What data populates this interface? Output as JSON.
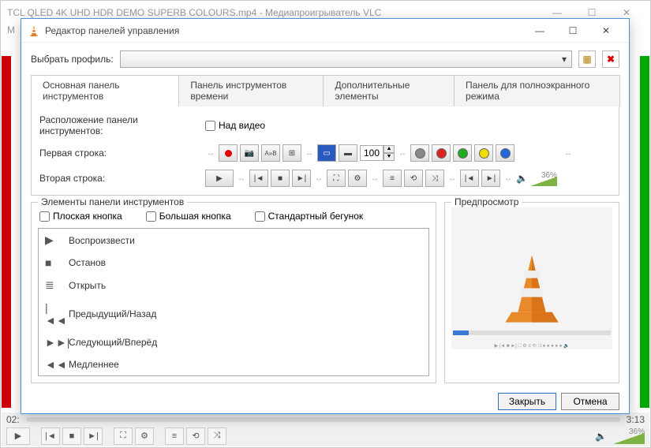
{
  "main_window": {
    "title": "TCL QLED 4K UHD HDR DEMO  SUPERB COLOURS.mp4 - Медиапроигрыватель VLC",
    "menu_first": "М",
    "time_left": "02:",
    "time_right": "3:13",
    "volume_pct": "36%"
  },
  "dialog": {
    "title": "Редактор панелей управления",
    "profile_label": "Выбрать профиль:",
    "tabs": [
      "Основная панель инструментов",
      "Панель инструментов времени",
      "Дополнительные элементы",
      "Панель для полноэкранного режима"
    ],
    "placement_label": "Расположение панели инструментов:",
    "above_video": "Над видео",
    "line1_label": "Первая строка:",
    "line2_label": "Вторая строка:",
    "spin_value": "100",
    "volume_pct": "36%",
    "elements_legend": "Элементы панели инструментов",
    "opt_flat": "Плоская кнопка",
    "opt_big": "Большая кнопка",
    "opt_slider": "Стандартный бегунок",
    "elements": [
      {
        "icon": "▶",
        "label": "Воспроизвести"
      },
      {
        "icon": "■",
        "label": "Останов"
      },
      {
        "icon": "≣",
        "label": "Открыть"
      },
      {
        "icon": "|◄◄",
        "label": "Предыдущий/Назад"
      },
      {
        "icon": "►►|",
        "label": "Следующий/Вперёд"
      },
      {
        "icon": "◄◄",
        "label": "Медленнее"
      }
    ],
    "preview_legend": "Предпросмотр",
    "close_btn": "Закрыть",
    "cancel_btn": "Отмена"
  },
  "colors": {
    "dots": [
      "#888",
      "#d22",
      "#2a2",
      "#ed0",
      "#26d"
    ]
  }
}
